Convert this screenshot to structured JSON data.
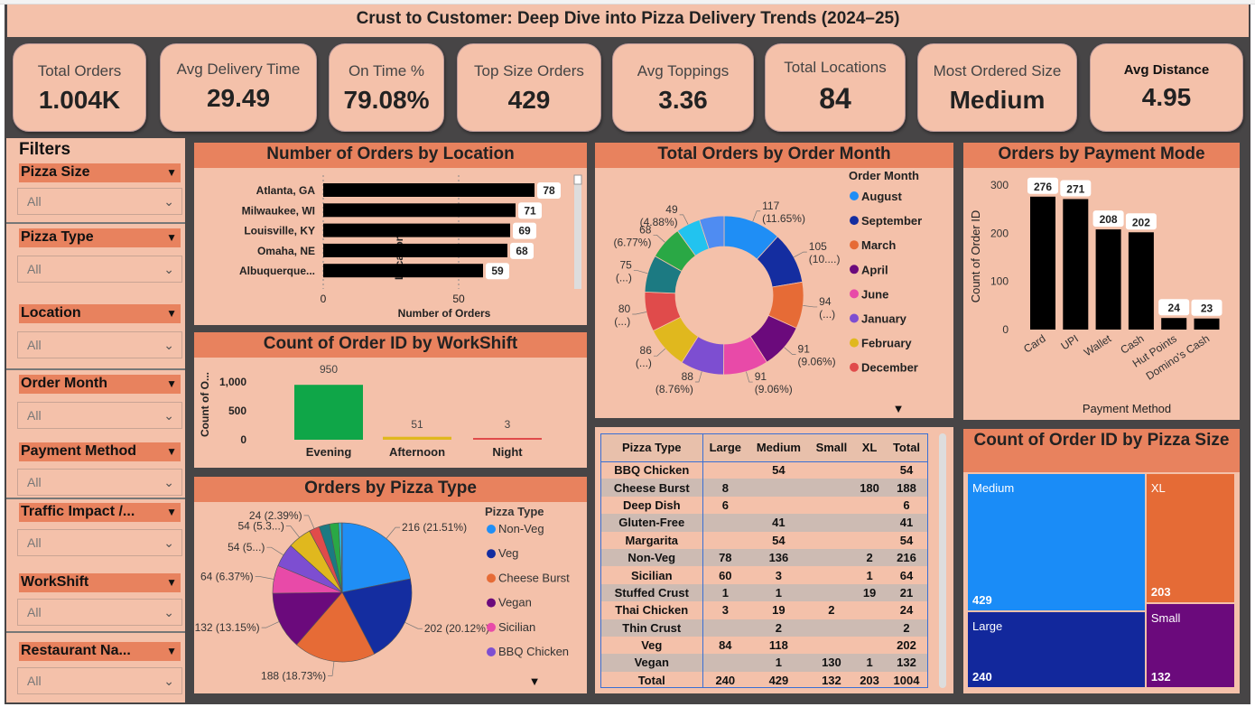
{
  "title": "Crust to Customer: Deep Dive into Pizza Delivery Trends (2024–25)",
  "kpis": [
    {
      "label": "Total Orders",
      "value": "1.004K",
      "color": "#1aa84a"
    },
    {
      "label": "Avg Delivery Time",
      "value": "29.49",
      "color": "#222222"
    },
    {
      "label": "On Time %",
      "value": "79.08%",
      "color": "#e01b1b"
    },
    {
      "label": "Top Size Orders",
      "value": "429",
      "color": "#222222"
    },
    {
      "label": "Avg Toppings",
      "value": "3.36",
      "color": "#222222"
    },
    {
      "label": "Total Locations",
      "value": "84",
      "color": "#222222"
    },
    {
      "label": "Most Ordered Size",
      "value": "Medium",
      "color": "#1e88f5"
    },
    {
      "label": "Avg Distance",
      "value": "4.95",
      "color": "#222222"
    }
  ],
  "filters": {
    "heading": "Filters",
    "items": [
      {
        "label": "Pizza Size",
        "value": "All"
      },
      {
        "label": "Pizza Type",
        "value": "All"
      },
      {
        "label": "Location",
        "value": "All"
      },
      {
        "label": "Order Month",
        "value": "All"
      },
      {
        "label": "Payment Method",
        "value": "All"
      },
      {
        "label": "Traffic Impact /...",
        "value": "All"
      },
      {
        "label": "WorkShift",
        "value": "All"
      },
      {
        "label": "Restaurant Na...",
        "value": "All"
      }
    ]
  },
  "location_chart": {
    "title": "Number of Orders by Location",
    "chart_data": {
      "type": "bar",
      "categories": [
        "Atlanta, GA",
        "Milwaukee, WI",
        "Louisville, KY",
        "Omaha, NE",
        "Albuquerque..."
      ],
      "values": [
        78,
        71,
        69,
        68,
        59
      ],
      "xlabel": "Number of Orders",
      "ylabel": "Location",
      "xticks": [
        "0",
        "50"
      ],
      "xlim": [
        0,
        90
      ],
      "bar_color": "#000000"
    }
  },
  "workshift_chart": {
    "title": "Count of Order ID by WorkShift",
    "chart_data": {
      "type": "bar",
      "categories": [
        "Evening",
        "Afternoon",
        "Night"
      ],
      "values": [
        950,
        51,
        3
      ],
      "labels": [
        "950",
        "51",
        "3"
      ],
      "colors": [
        "#0fa648",
        "#e0b81e",
        "#e04b4b"
      ],
      "ylabel": "Count of O...",
      "yticks": [
        "1,000",
        "500",
        "0"
      ],
      "ylim": [
        0,
        1000
      ]
    }
  },
  "pizza_type_chart": {
    "title": "Orders by Pizza Type",
    "legend_title": "Pizza Type",
    "legend": [
      "Non-Veg",
      "Veg",
      "Cheese Burst",
      "Vegan",
      "Sicilian",
      "BBQ Chicken"
    ],
    "chart_data": {
      "type": "pie",
      "slices": [
        {
          "name": "Non-Veg",
          "value": 216,
          "label": "216 (21.51%)",
          "color": "#1f8ef5"
        },
        {
          "name": "Veg",
          "value": 202,
          "label": "202 (20.12%)",
          "color": "#142da0"
        },
        {
          "name": "Cheese Burst",
          "value": 188,
          "label": "188 (18.73%)",
          "color": "#e66b36"
        },
        {
          "name": "Vegan",
          "value": 132,
          "label": "132 (13.15%)",
          "color": "#6b0a7c"
        },
        {
          "name": "Sicilian",
          "value": 64,
          "label": "64 (6.37%)",
          "color": "#e84aa8"
        },
        {
          "name": "BBQ Chicken",
          "value": 54,
          "label": "54 (5...)",
          "color": "#7d4ed1"
        },
        {
          "name": "Margarita",
          "value": 54,
          "label": "54 (5.3...)",
          "color": "#e0b81e"
        },
        {
          "name": "",
          "value": 24,
          "label": "24 (2.39%)",
          "color": "#e04b4b"
        },
        {
          "name": "",
          "value": 24,
          "label": "",
          "color": "#1c7a82"
        },
        {
          "name": "",
          "value": 21,
          "label": "",
          "color": "#2aa845"
        },
        {
          "name": "",
          "value": 6,
          "label": "",
          "color": "#22c3ef"
        },
        {
          "name": "",
          "value": 2,
          "label": "",
          "color": "#5b8ff0"
        }
      ]
    }
  },
  "month_chart": {
    "title": "Total Orders by Order Month",
    "legend_title": "Order Month",
    "legend": [
      "August",
      "September",
      "March",
      "April",
      "June",
      "January",
      "February",
      "December"
    ],
    "chart_data": {
      "type": "pie",
      "donut": true,
      "slices": [
        {
          "name": "August",
          "value": 117,
          "label": "117 (11.65%)",
          "color": "#1f8ef5"
        },
        {
          "name": "September",
          "value": 105,
          "label": "105 (10....)",
          "color": "#142da0"
        },
        {
          "name": "March",
          "value": 94,
          "label": "94 (...)",
          "color": "#e66b36"
        },
        {
          "name": "April",
          "value": 91,
          "label": "91 (9.06%)",
          "color": "#6b0a7c"
        },
        {
          "name": "June",
          "value": 91,
          "label": "91 (9.06%)",
          "color": "#e84aa8"
        },
        {
          "name": "January",
          "value": 88,
          "label": "88 (8.76%)",
          "color": "#7d4ed1"
        },
        {
          "name": "February",
          "value": 86,
          "label": "86 (...)",
          "color": "#e0b81e"
        },
        {
          "name": "December",
          "value": 80,
          "label": "80 (...)",
          "color": "#e04b4b"
        },
        {
          "name": "",
          "value": 75,
          "label": "75 (...)",
          "color": "#1c7a82"
        },
        {
          "name": "",
          "value": 68,
          "label": "68 (6.77%)",
          "color": "#2aa845"
        },
        {
          "name": "",
          "value": 49,
          "label": "49 (4.88%)",
          "color": "#22c3ef"
        },
        {
          "name": "",
          "value": 50,
          "label": "",
          "color": "#4f8cf2"
        }
      ]
    }
  },
  "payment_chart": {
    "title": "Orders by Payment Mode",
    "chart_data": {
      "type": "bar",
      "categories": [
        "Card",
        "UPI",
        "Wallet",
        "Cash",
        "Hut Points",
        "Domino's Cash"
      ],
      "values": [
        276,
        271,
        208,
        202,
        24,
        23
      ],
      "ylabel": "Count of Order ID",
      "xlabel": "Payment Method",
      "yticks": [
        "300",
        "200",
        "100",
        "0"
      ],
      "ylim": [
        0,
        300
      ],
      "bar_color": "#000000"
    }
  },
  "matrix": {
    "headers": [
      "Pizza Type",
      "Large",
      "Medium",
      "Small",
      "XL",
      "Total"
    ],
    "rows": [
      [
        "BBQ Chicken",
        "",
        "54",
        "",
        "",
        "54"
      ],
      [
        "Cheese Burst",
        "8",
        "",
        "",
        "180",
        "188"
      ],
      [
        "Deep Dish",
        "6",
        "",
        "",
        "",
        "6"
      ],
      [
        "Gluten-Free",
        "",
        "41",
        "",
        "",
        "41"
      ],
      [
        "Margarita",
        "",
        "54",
        "",
        "",
        "54"
      ],
      [
        "Non-Veg",
        "78",
        "136",
        "",
        "2",
        "216"
      ],
      [
        "Sicilian",
        "60",
        "3",
        "",
        "1",
        "64"
      ],
      [
        "Stuffed Crust",
        "1",
        "1",
        "",
        "19",
        "21"
      ],
      [
        "Thai Chicken",
        "3",
        "19",
        "2",
        "",
        "24"
      ],
      [
        "Thin Crust",
        "",
        "2",
        "",
        "",
        "2"
      ],
      [
        "Veg",
        "84",
        "118",
        "",
        "",
        "202"
      ],
      [
        "Vegan",
        "",
        "1",
        "130",
        "1",
        "132"
      ],
      [
        "Total",
        "240",
        "429",
        "132",
        "203",
        "1004"
      ]
    ]
  },
  "size_chart": {
    "title": "Count of Order ID by Pizza Size",
    "chart_data": {
      "type": "treemap",
      "items": [
        {
          "name": "Medium",
          "value": 429,
          "color": "#1a8cf7"
        },
        {
          "name": "XL",
          "value": 203,
          "color": "#e56b36"
        },
        {
          "name": "Large",
          "value": 240,
          "color": "#12289c"
        },
        {
          "name": "Small",
          "value": 132,
          "color": "#6b0a7c"
        }
      ]
    }
  }
}
